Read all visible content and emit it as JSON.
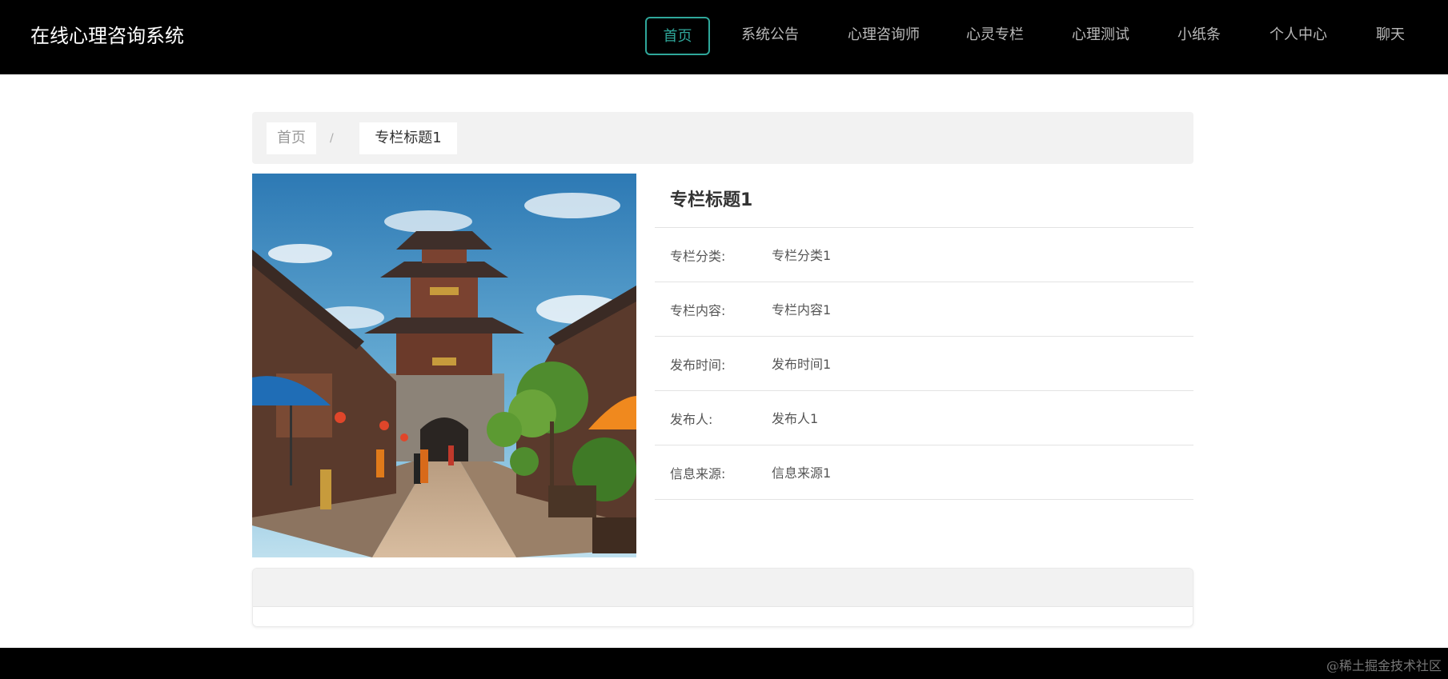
{
  "header": {
    "title": "在线心理咨询系统",
    "nav": [
      {
        "label": "首页",
        "active": true
      },
      {
        "label": "系统公告",
        "active": false
      },
      {
        "label": "心理咨询师",
        "active": false
      },
      {
        "label": "心灵专栏",
        "active": false
      },
      {
        "label": "心理测试",
        "active": false
      },
      {
        "label": "小纸条",
        "active": false
      },
      {
        "label": "个人中心",
        "active": false
      },
      {
        "label": "聊天",
        "active": false
      }
    ],
    "accent_color": "#2fa79a"
  },
  "breadcrumb": {
    "home": "首页",
    "separator": "/",
    "current": "专栏标题1"
  },
  "detail": {
    "title": "专栏标题1",
    "rows": [
      {
        "label": "专栏分类:",
        "value": "专栏分类1"
      },
      {
        "label": "专栏内容:",
        "value": "专栏内容1"
      },
      {
        "label": "发布时间:",
        "value": "发布时间1"
      },
      {
        "label": "发布人:",
        "value": "发布人1"
      },
      {
        "label": "信息来源:",
        "value": "信息来源1"
      }
    ]
  },
  "footer": {
    "watermark": "@稀土掘金技术社区"
  }
}
